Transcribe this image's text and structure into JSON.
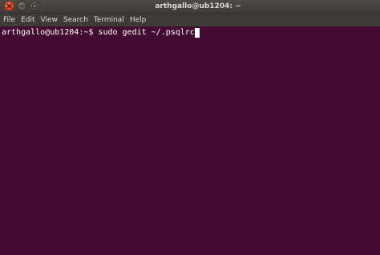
{
  "window": {
    "title": "arthgallo@ub1204: ~",
    "buttons": {
      "close_glyph": "×",
      "minimize_glyph": "−",
      "maximize_glyph": "□"
    }
  },
  "menubar": {
    "items": [
      "File",
      "Edit",
      "View",
      "Search",
      "Terminal",
      "Help"
    ]
  },
  "terminal": {
    "prompt": "arthgallo@ub1204:~$ ",
    "command": "sudo gedit ~/.psqlrc",
    "colors": {
      "background": "#430a32",
      "foreground": "#ffffff"
    }
  }
}
